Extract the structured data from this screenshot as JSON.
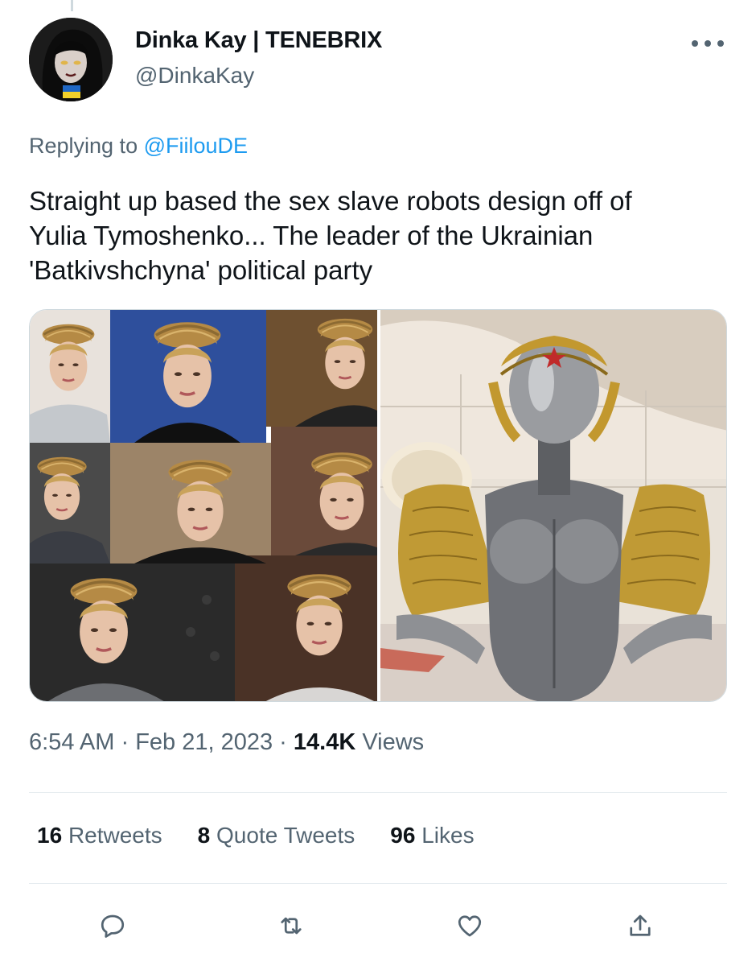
{
  "author": {
    "display_name": "Dinka Kay | TENEBRIX",
    "handle": "@DinkaKay"
  },
  "reply": {
    "prefix": "Replying to ",
    "to_handle": "@FiilouDE"
  },
  "tweet": {
    "lines": [
      "Straight up based the sex slave robots design off of",
      "Yulia Tymoshenko... The leader of the Ukrainian",
      "'Batkivshchyna' political party"
    ]
  },
  "meta": {
    "time": "6:54 AM",
    "separator": " · ",
    "date": "Feb 21, 2023",
    "views_count": "14.4K",
    "views_label": "Views"
  },
  "stats": {
    "retweets_count": "16",
    "retweets_label": "Retweets",
    "quotes_count": "8",
    "quotes_label": "Quote Tweets",
    "likes_count": "96",
    "likes_label": "Likes"
  },
  "icons": {
    "more": "more-horizontal-icon",
    "reply": "reply-icon",
    "retweet": "retweet-icon",
    "like": "heart-icon",
    "share": "share-icon"
  },
  "colors": {
    "text_primary": "#0f1419",
    "text_secondary": "#536471",
    "link": "#1d9bf0",
    "divider": "#e6ecf0"
  }
}
